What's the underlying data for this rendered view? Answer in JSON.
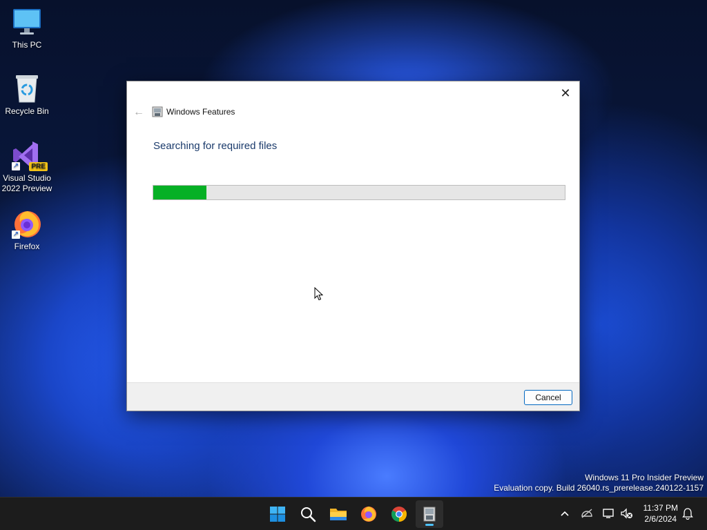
{
  "desktop": {
    "icons": [
      {
        "label": "This PC"
      },
      {
        "label": "Recycle Bin"
      },
      {
        "label_line1": "Visual Studio",
        "label_line2": "2022 Preview",
        "badge": "PRE"
      },
      {
        "label": "Firefox"
      }
    ]
  },
  "dialog": {
    "title": "Windows Features",
    "heading": "Searching for required files",
    "progress_fraction": 0.13,
    "cancel_label": "Cancel",
    "close_glyph": "✕",
    "back_glyph": "←"
  },
  "watermark": {
    "line1": "Windows 11 Pro Insider Preview",
    "line2": "Evaluation copy. Build 26040.rs_prerelease.240122-1157"
  },
  "taskbar": {
    "apps": [
      "start-icon",
      "search-icon",
      "file-explorer-icon",
      "firefox-icon",
      "chrome-icon",
      "windows-features-icon"
    ],
    "tray": [
      "chevron-up-icon",
      "network-icon",
      "display-icon",
      "volume-muted-icon",
      "notification-bell-icon"
    ],
    "time": "11:37 PM",
    "date": "2/6/2024"
  },
  "colors": {
    "progress_fill": "#06b025",
    "progress_track": "#e6e6e6",
    "accent": "#0067c0",
    "taskbar_indicator": "#4cc2ff"
  }
}
